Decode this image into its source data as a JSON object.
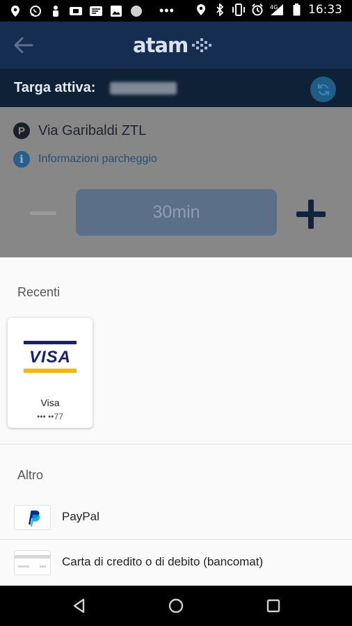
{
  "status_bar": {
    "time": "16:33",
    "network": "4G",
    "left_icons": [
      "location-icon",
      "whatsapp-icon",
      "person-icon",
      "ticket-icon",
      "cast-icon",
      "image-icon",
      "circle-icon"
    ],
    "overflow": "•••",
    "right_icons": [
      "location-icon",
      "bluetooth-icon",
      "vibrate-icon",
      "alarm-icon",
      "signal-icon",
      "battery-icon"
    ]
  },
  "app_bar": {
    "logo_text": "atam"
  },
  "plate_bar": {
    "label": "Targa attiva:"
  },
  "parking": {
    "p_icon_text": "P",
    "street": "Via Garibaldi ZTL",
    "info_icon_text": "i",
    "info_link": "Informazioni parcheggio",
    "duration": "30min"
  },
  "payment": {
    "recent_title": "Recenti",
    "recent_cards": [
      {
        "brand_mark": "VISA",
        "name": "Visa",
        "number": "••• ••77"
      }
    ],
    "other_title": "Altro",
    "other_methods": [
      {
        "label": "PayPal",
        "icon": "paypal-icon"
      },
      {
        "label": "Carta di credito o di debito (bancomat)",
        "icon": "credit-card-icon"
      }
    ]
  },
  "colors": {
    "app_bar": "#142d51",
    "plate_bar": "#0f2137",
    "accent_refresh": "#1f5c86",
    "visa_blue": "#1a1f71",
    "visa_gold": "#f7b600",
    "paypal_blue": "#003087"
  }
}
